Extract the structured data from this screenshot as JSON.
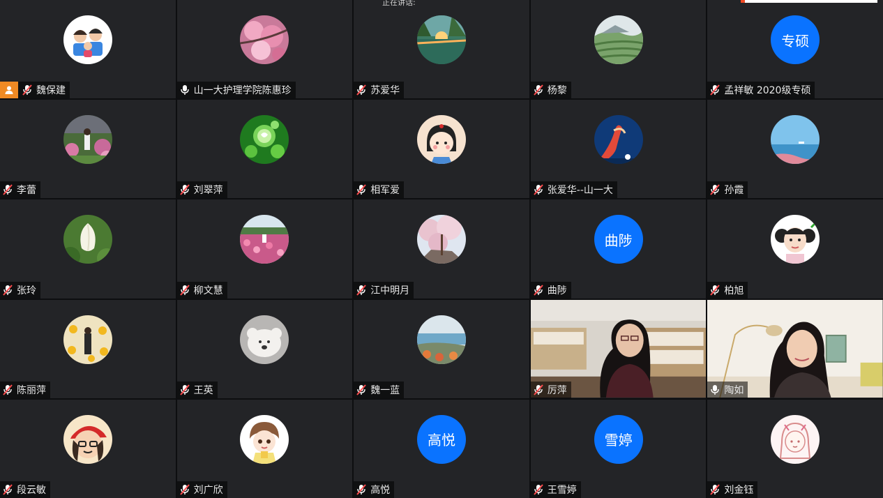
{
  "meeting": {
    "speaking_text": "正在讲话:"
  },
  "participants": [
    {
      "name": "魏保建",
      "mic": "muted",
      "avatar": "photo-family-cartoon",
      "host": true
    },
    {
      "name": "山一大护理学院陈惠珍",
      "mic": "on",
      "avatar": "photo-pink-blossom"
    },
    {
      "name": "苏爱华",
      "mic": "muted",
      "avatar": "photo-sunset-lake"
    },
    {
      "name": "杨黎",
      "mic": "muted",
      "avatar": "photo-green-terraces"
    },
    {
      "name": "孟祥敏 2020级专硕",
      "mic": "muted",
      "avatar_text": "专硕"
    },
    {
      "name": "李蕾",
      "mic": "muted",
      "avatar": "photo-garden-person"
    },
    {
      "name": "刘翠萍",
      "mic": "muted",
      "avatar": "photo-green-bubbles"
    },
    {
      "name": "相军爱",
      "mic": "muted",
      "avatar": "cartoon-girl"
    },
    {
      "name": "张爱华--山一大",
      "mic": "muted",
      "avatar": "photo-blue-art"
    },
    {
      "name": "孙霞",
      "mic": "muted",
      "avatar": "photo-sea-sky"
    },
    {
      "name": "张玲",
      "mic": "muted",
      "avatar": "photo-white-lotus"
    },
    {
      "name": "柳文慧",
      "mic": "muted",
      "avatar": "photo-flower-field"
    },
    {
      "name": "江中明月",
      "mic": "muted",
      "avatar": "photo-cherry-blossom"
    },
    {
      "name": "曲陟",
      "mic": "muted",
      "avatar_text": "曲陟"
    },
    {
      "name": "柏旭",
      "mic": "muted",
      "avatar": "photo-child"
    },
    {
      "name": "陈丽萍",
      "mic": "muted",
      "avatar": "photo-sunflowers"
    },
    {
      "name": "王英",
      "mic": "muted",
      "avatar": "photo-plush-bear"
    },
    {
      "name": "魏一蓝",
      "mic": "muted",
      "avatar": "photo-coast"
    },
    {
      "name": "厉萍",
      "mic": "muted",
      "video": true
    },
    {
      "name": "陶如",
      "mic": "on",
      "video": true
    },
    {
      "name": "段云敏",
      "mic": "muted",
      "avatar": "cartoon-red-cap"
    },
    {
      "name": "刘广欣",
      "mic": "muted",
      "avatar": "cartoon-boy"
    },
    {
      "name": "高悦",
      "mic": "muted",
      "avatar_text": "高悦"
    },
    {
      "name": "王雪婷",
      "mic": "muted",
      "avatar_text": "雪婷"
    },
    {
      "name": "刘金钰",
      "mic": "muted",
      "avatar": "cartoon-sketch-girl"
    }
  ],
  "colors": {
    "tile_bg": "#232427",
    "avatar_text_bg": "#0a73ff",
    "host_badge": "#f08a24",
    "muted_slash": "#ff4d4f"
  }
}
